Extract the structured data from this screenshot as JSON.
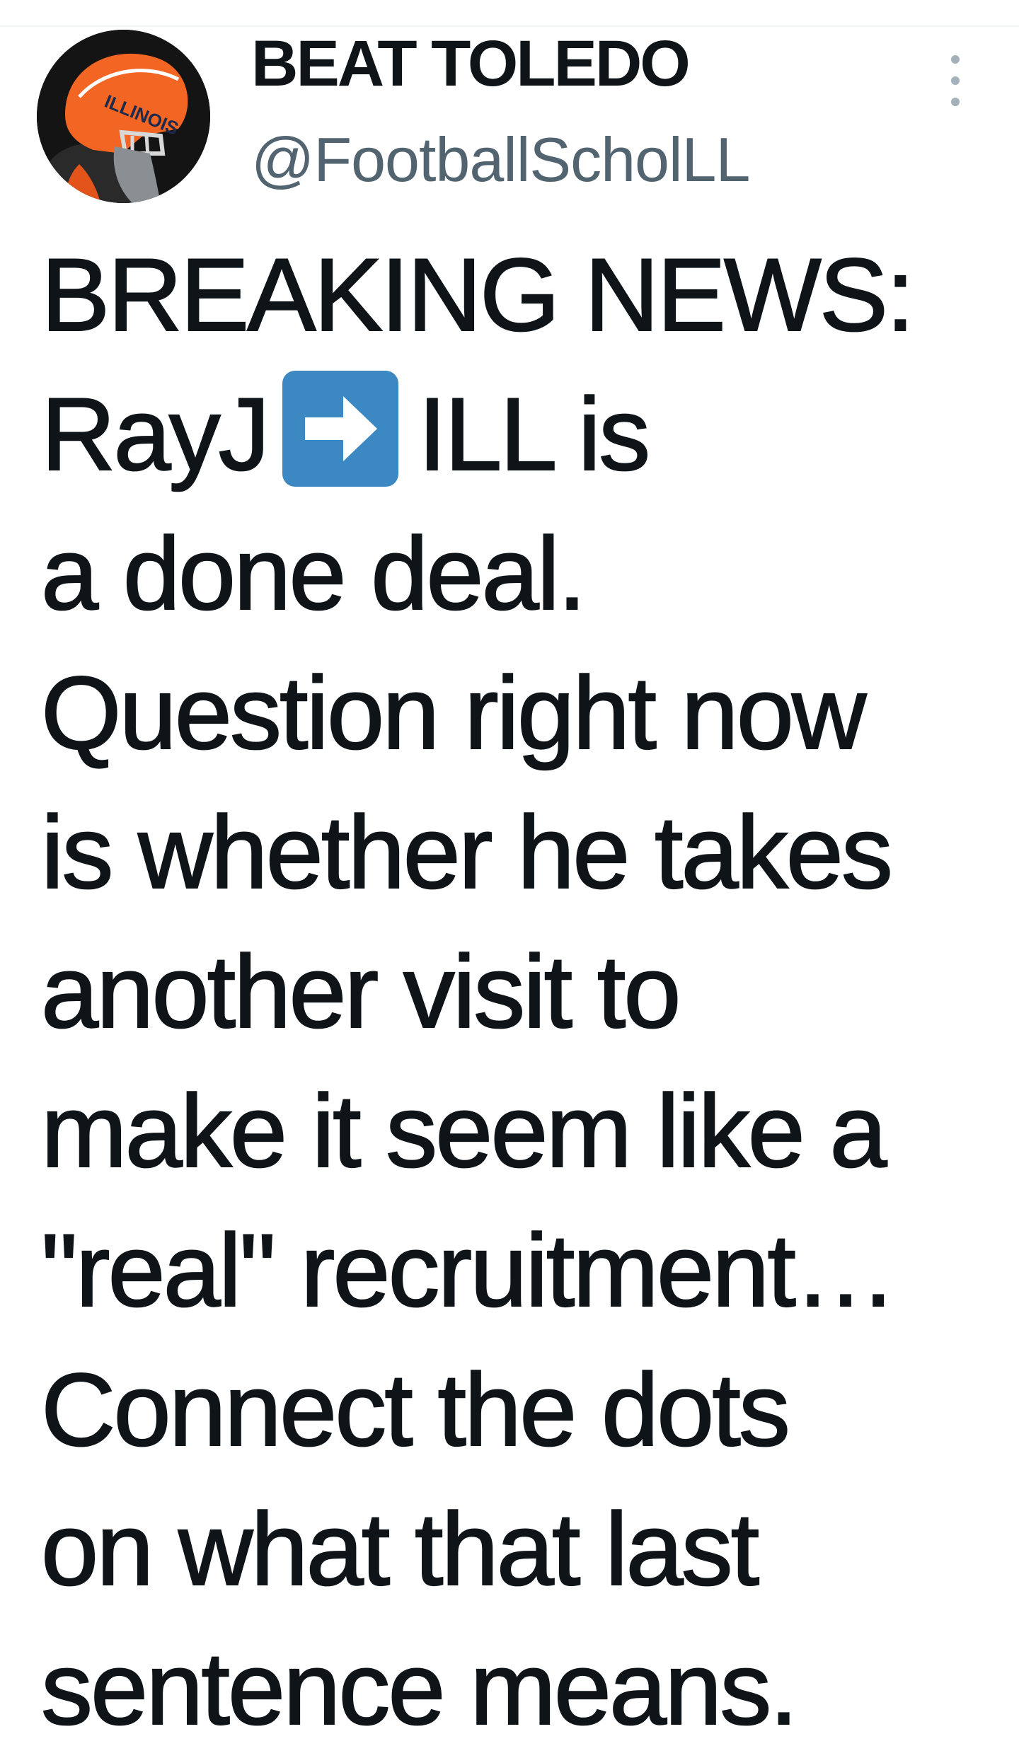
{
  "tweet": {
    "author": {
      "display_name": "BEAT TOLEDO",
      "handle": "@FootballScholLL",
      "avatar": {
        "icon": "football-helmet-avatar",
        "helmet_text": "ILLINOIS",
        "helmet_color": "#f26522",
        "background_color": "#141414"
      }
    },
    "more_icon": "more-vertical-icon",
    "text_lines": {
      "l1": "BREAKING NEWS:",
      "l2_before": "RayJ",
      "l2_after": "ILL is",
      "l3": "a done deal.",
      "l4": "Question right now",
      "l5": "is whether he takes",
      "l6": "another visit to",
      "l7": "make it seem like a",
      "l8": "\"real\" recruitment…",
      "l9": "Connect the dots",
      "l10": "on what that last",
      "l11": "sentence means."
    },
    "emoji": {
      "icon": "right-arrow-emoji-icon",
      "color": "#3b88c3"
    }
  }
}
